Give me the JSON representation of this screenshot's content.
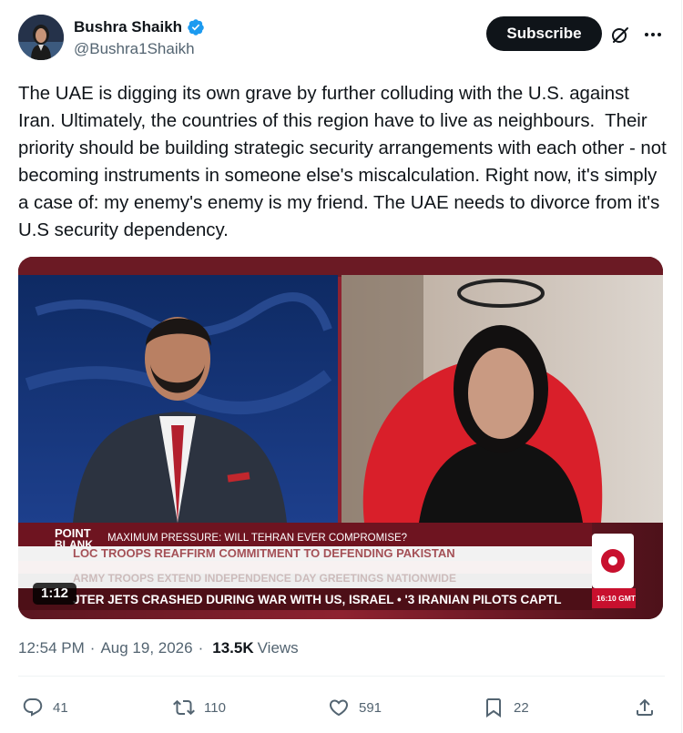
{
  "author": {
    "display_name": "Bushra Shaikh",
    "handle": "@Bushra1Shaikh",
    "verified": true
  },
  "header": {
    "subscribe_label": "Subscribe",
    "grok_icon": "grok-icon",
    "more_icon": "more-dots-icon"
  },
  "tweet": {
    "text": "The UAE is digging its own grave by further colluding with the U.S. against Iran. Ultimately, the countries of this region have to live as neighbours.  Their priority should be building strategic security arrangements with each other - not becoming instruments in someone else's miscalculation. Right now, it's simply a case of: my enemy's enemy is my friend. The UAE needs to divorce from it's U.S security dependency."
  },
  "video": {
    "duration": "1:12",
    "show_name_top": "POINT",
    "show_name_bottom": "BLANK",
    "headline": "MAXIMUM PRESSURE: WILL TEHRAN EVER COMPROMISE?",
    "ticker_line_1": "LOC TROOPS REAFFIRM COMMITMENT TO DEFENDING PAKISTAN",
    "ticker_line_2": "ARMY TROOPS EXTEND INDEPENDENCE DAY GREETINGS NATIONWIDE",
    "ticker_line_3": "JTER JETS CRASHED DURING WAR WITH US, ISRAEL   •  '3 IRANIAN PILOTS CAPTL",
    "clock": "16:10 GMT"
  },
  "meta": {
    "time": "12:54 PM",
    "separator": "·",
    "date": "Aug 19, 2026",
    "views_count": "13.5K",
    "views_label": "Views"
  },
  "actions": {
    "replies": "41",
    "reposts": "110",
    "likes": "591",
    "bookmarks": "22"
  },
  "colors": {
    "text_primary": "#0f1419",
    "text_secondary": "#536471",
    "verified_blue": "#1d9bf0",
    "ticker_red": "#c8102e"
  }
}
